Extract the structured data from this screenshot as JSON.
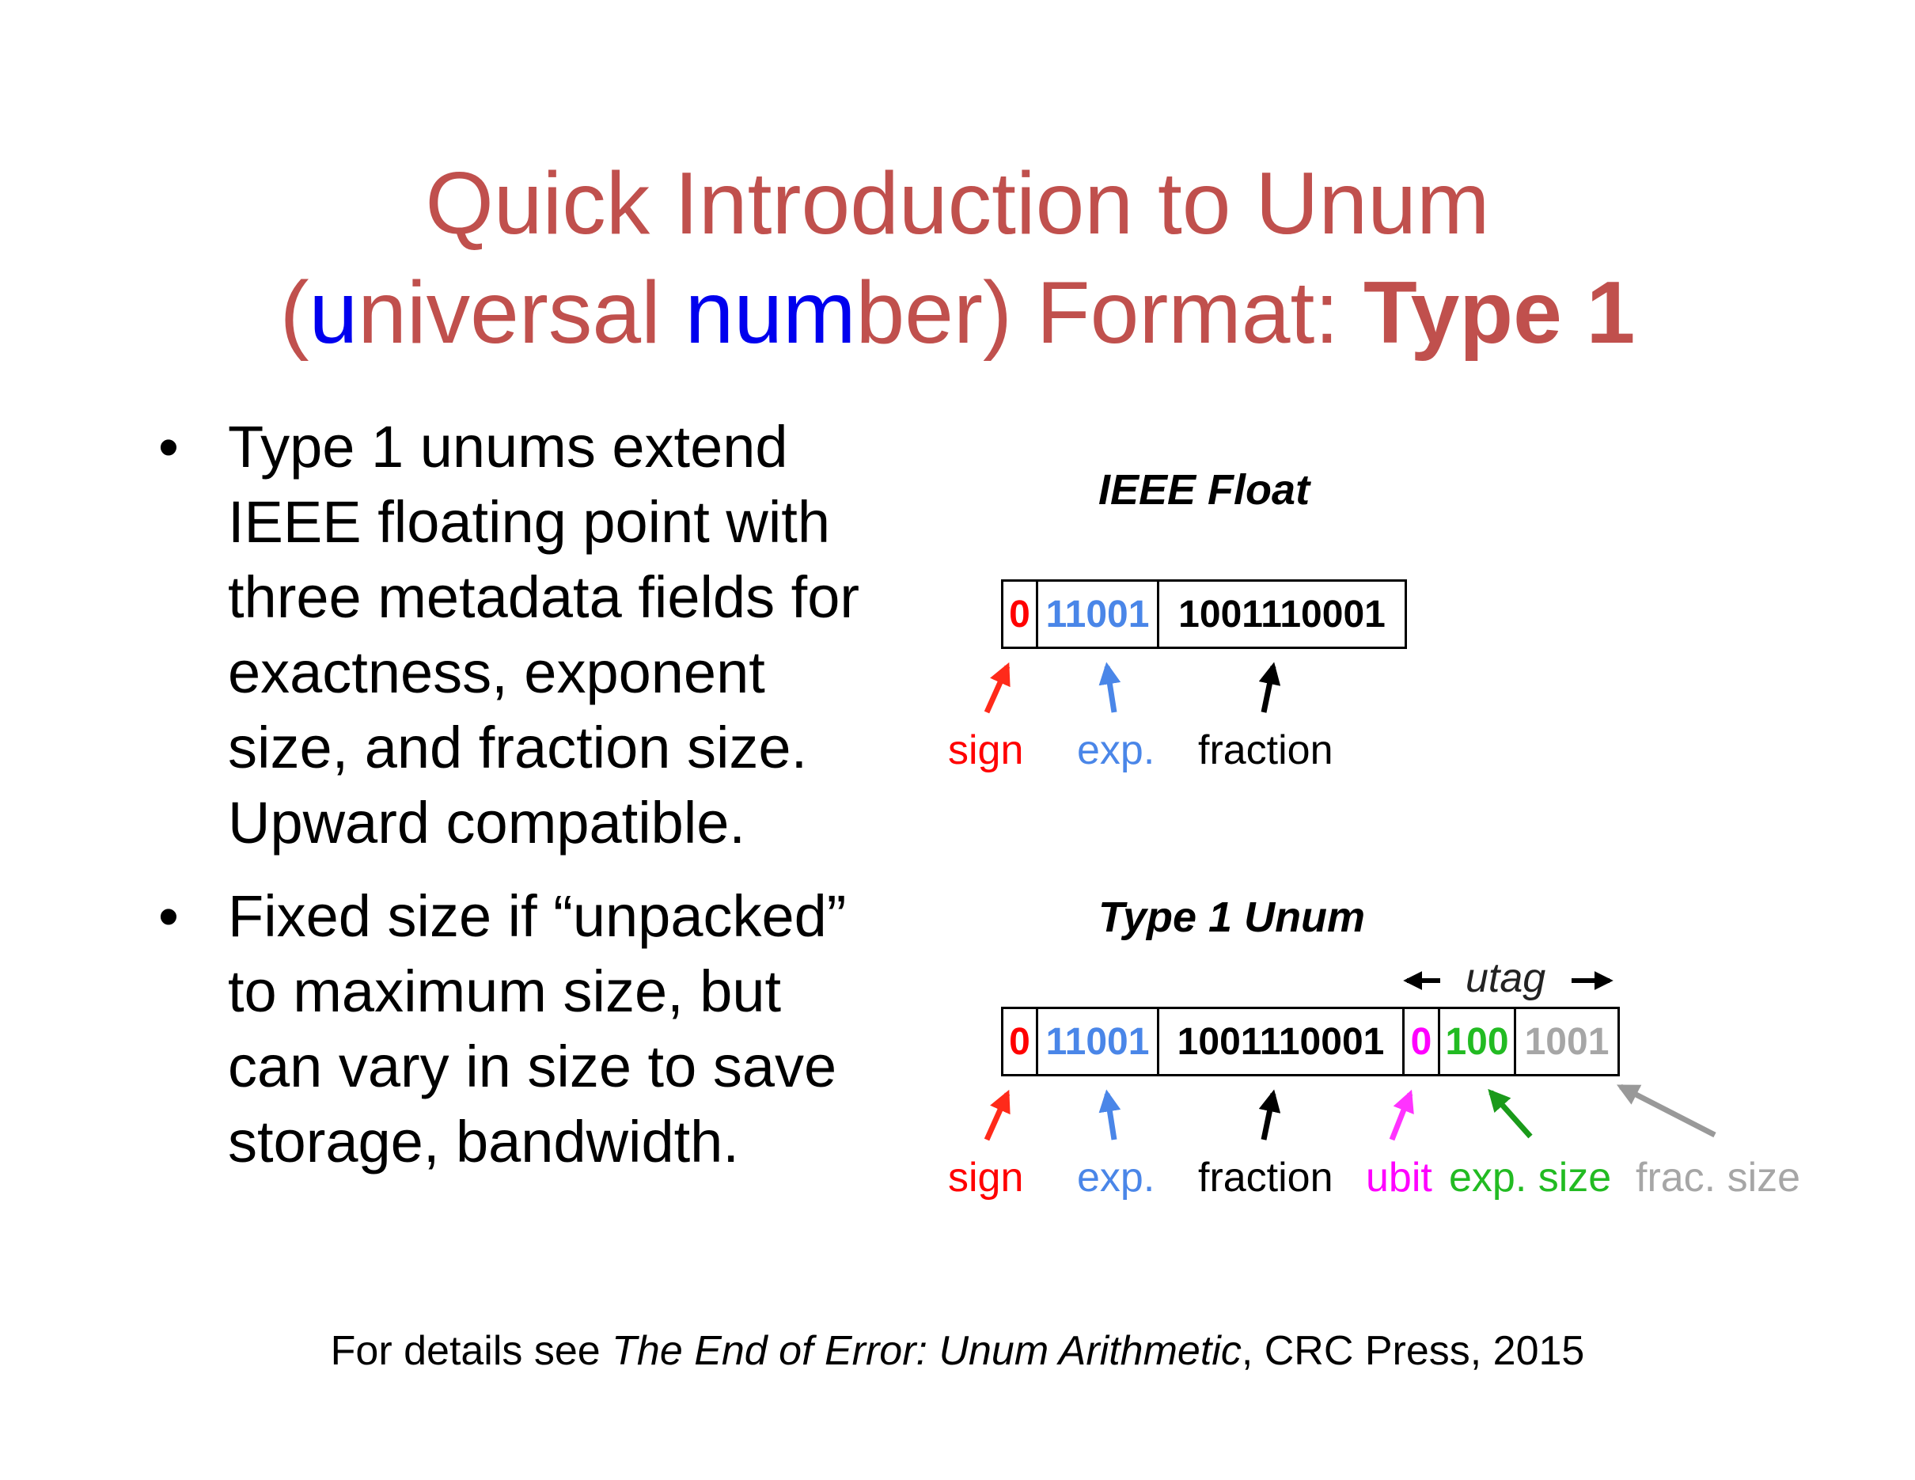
{
  "title": {
    "line1": "Quick Introduction to Unum",
    "paren_open": "(",
    "u": "u",
    "niversal": "niversal ",
    "num": "num",
    "ber_close": "ber) Format: ",
    "type1": "Type 1"
  },
  "bullets": [
    {
      "symbol": "•",
      "lines": [
        "Type 1 unums extend",
        "IEEE floating point with",
        "three metadata fields for",
        "exactness, exponent",
        "size, and fraction size.",
        "Upward compatible."
      ]
    },
    {
      "symbol": "•",
      "lines": [
        "Fixed size if “unpacked”",
        "to maximum size, but",
        "can vary in size to save",
        "storage, bandwidth."
      ]
    }
  ],
  "ieee": {
    "title": "IEEE Float",
    "fields": {
      "sign": "0",
      "exp": "11001",
      "frac": "1001110001"
    },
    "labels": {
      "sign": "sign",
      "exp": "exp.",
      "frac": "fraction"
    }
  },
  "unum": {
    "title": "Type 1 Unum",
    "utag": "utag",
    "fields": {
      "sign": "0",
      "exp": "11001",
      "frac": "1001110001",
      "ubit": "0",
      "es": "100",
      "fs": "1001"
    },
    "labels": {
      "sign": "sign",
      "exp": "exp.",
      "frac": "fraction",
      "ubit": "ubit",
      "es": "exp. size",
      "fs": "frac. size"
    }
  },
  "footer": {
    "pre": "For details see ",
    "book": "The End of Error: Unum Arithmetic",
    "post": ", CRC Press, 2015"
  },
  "colors": {
    "title": "#c0504d",
    "highlight": "#0000ee",
    "sign": "#ff0000",
    "exp": "#4a86e8",
    "ubit": "#ff00ff",
    "exp_size": "#22bb22",
    "frac_size": "#a6a6a6",
    "arrow_sign": "#ff2a1a",
    "arrow_es": "#1a9a1a",
    "arrow_fs": "#999999"
  }
}
